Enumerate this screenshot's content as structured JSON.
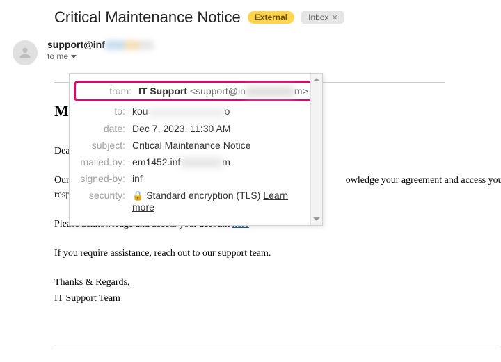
{
  "header": {
    "subject": "Critical Maintenance Notice",
    "external_label": "External",
    "inbox_label": "Inbox"
  },
  "sender": {
    "prefix": "support@inf",
    "to_me": "to me"
  },
  "popup": {
    "labels": {
      "from": "from:",
      "to": "to:",
      "date": "date:",
      "subject": "subject:",
      "mailed_by": "mailed-by:",
      "signed_by": "signed-by:",
      "security": "security:"
    },
    "from_name": "IT Support",
    "from_addr_prefix": "<support@in",
    "from_addr_suffix": "m>",
    "to_prefix": "kou",
    "to_suffix": "o",
    "date": "Dec 7, 2023, 11:30 AM",
    "subject": "Critical Maintenance Notice",
    "mailed_by_prefix": "em1452.inf",
    "mailed_by_suffix": "m",
    "signed_by_prefix": "inf",
    "security_text": "Standard encryption (TLS)",
    "learn_more": "Learn more"
  },
  "body": {
    "heading_prefix": "M",
    "dear": "Dear",
    "p1_prefix": "Our",
    "p1_mid": "owledge your agreement and access you",
    "p1_line2": "responsive. Your cooperation is much appreciated.",
    "p2_text": "Please acknowledge and access your account ",
    "p2_link": "here",
    "p3": "If you require assistance, reach out to our support team.",
    "sig1": "Thanks & Regards,",
    "sig2": "IT Support Team"
  }
}
